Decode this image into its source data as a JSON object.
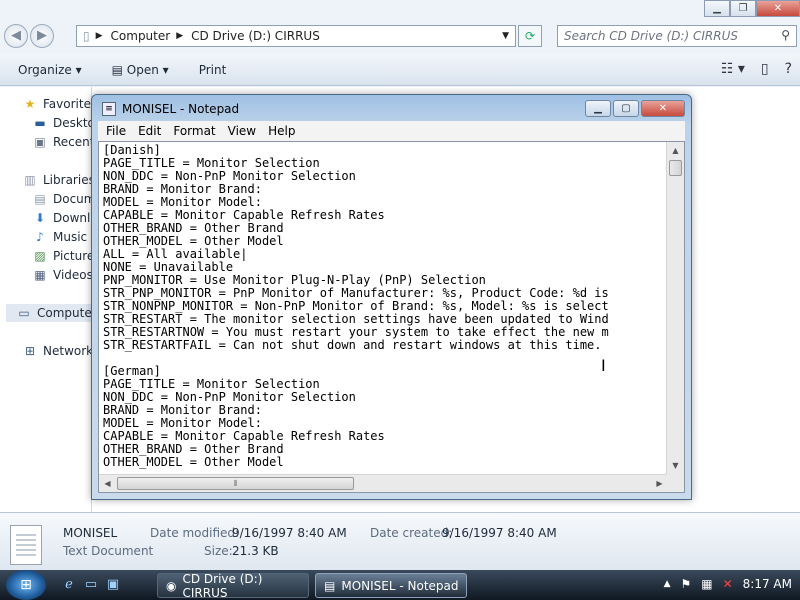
{
  "explorer": {
    "address": {
      "computer": "Computer",
      "drive": "CD Drive (D:) CIRRUS"
    },
    "search_placeholder": "Search CD Drive (D:) CIRRUS",
    "toolbar": {
      "organize": "Organize",
      "open": "Open",
      "print": "Print"
    },
    "nav": {
      "favorites": "Favorites",
      "desktop": "Desktop",
      "recent": "Recent",
      "libraries": "Libraries",
      "documents": "Docum",
      "downloads": "Downlo",
      "music": "Music",
      "pictures": "Pictures",
      "videos": "Videos",
      "computer": "Compute",
      "network": "Network"
    },
    "details": {
      "file_name": "MONISEL",
      "file_type": "Text Document",
      "modified_label": "Date modified:",
      "modified_value": "9/16/1997 8:40 AM",
      "created_label": "Date created:",
      "created_value": "9/16/1997 8:40 AM",
      "size_label": "Size:",
      "size_value": "21.3 KB"
    }
  },
  "notepad": {
    "title": "MONISEL - Notepad",
    "menu": {
      "file": "File",
      "edit": "Edit",
      "format": "Format",
      "view": "View",
      "help": "Help"
    },
    "content": "[Danish]\nPAGE_TITLE = Monitor Selection\nNON_DDC = Non-PnP Monitor Selection\nBRAND = Monitor Brand:\nMODEL = Monitor Model:\nCAPABLE = Monitor Capable Refresh Rates\nOTHER_BRAND = Other Brand\nOTHER_MODEL = Other Model\nALL = All available|\nNONE = Unavailable\nPNP_MONITOR = Use Monitor Plug-N-Play (PnP) Selection\nSTR_PNP_MONITOR = PnP Monitor of Manufacturer: %s, Product Code: %d is\nSTR_NONPNP_MONITOR = Non-PnP Monitor of Brand: %s, Model: %s is select\nSTR_RESTART = The monitor selection settings have been updated to Wind\nSTR_RESTARTNOW = You must restart your system to take effect the new m\nSTR_RESTARTFAIL = Can not shut down and restart windows at this time.\n\n[German]\nPAGE_TITLE = Monitor Selection\nNON_DDC = Non-PnP Monitor Selection\nBRAND = Monitor Brand:\nMODEL = Monitor Model:\nCAPABLE = Monitor Capable Refresh Rates\nOTHER_BRAND = Other Brand\nOTHER_MODEL = Other Model"
  },
  "taskbar": {
    "tasks": [
      {
        "label": "CD Drive (D:) CIRRUS"
      },
      {
        "label": "MONISEL - Notepad"
      }
    ],
    "clock": "8:17 AM"
  },
  "icons": {
    "back": "back-arrow-icon",
    "forward": "forward-arrow-icon",
    "refresh": "refresh-icon",
    "search": "search-icon",
    "start": "windows-start-icon"
  }
}
